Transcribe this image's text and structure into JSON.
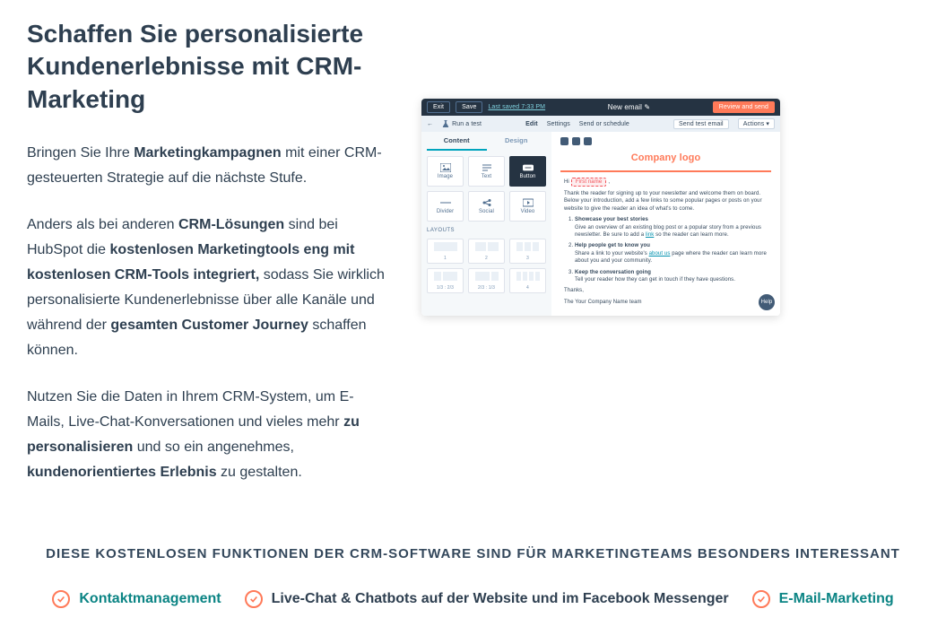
{
  "heading": "Schaffen Sie personalisierte Kundenerlebnisse mit CRM-Marketing",
  "paragraphs": {
    "p1a": "Bringen Sie Ihre ",
    "p1b": "Marketingkampagnen",
    "p1c": " mit einer CRM-gesteuerten Strategie auf die nächste Stufe.",
    "p2a": "Anders als bei anderen ",
    "p2b": "CRM-Lösungen",
    "p2c": " sind bei HubSpot die ",
    "p2d": "kostenlosen Marketingtools eng mit kostenlosen CRM-Tools integriert,",
    "p2e": " sodass Sie wirklich personalisierte Kundenerlebnisse über alle Kanäle und während der ",
    "p2f": "gesamten Customer Journey",
    "p2g": " schaffen können.",
    "p3a": "Nutzen Sie die Daten in Ihrem CRM-System, um E-Mails, Live-Chat-Konversationen und vieles mehr ",
    "p3b": "zu personalisieren",
    "p3c": " und so ein angenehmes, ",
    "p3d": "kundenorientiertes Erlebnis",
    "p3e": " zu gestalten."
  },
  "editor": {
    "exit": "Exit",
    "save": "Save",
    "last_saved": "Last saved 7:33 PM",
    "title": "New email",
    "pencil": "✎",
    "review": "Review and send",
    "back": "←",
    "run_test": "Run a test",
    "tabs_top": {
      "edit": "Edit",
      "settings": "Settings",
      "send": "Send or schedule"
    },
    "send_test": "Send test email",
    "actions": "Actions ▾",
    "side_tabs": {
      "content": "Content",
      "design": "Design"
    },
    "blocks": {
      "image": "Image",
      "text": "Text",
      "button": "Button",
      "divider": "Divider",
      "social": "Social",
      "video": "Video"
    },
    "layouts_label": "LAYOUTS",
    "layouts": [
      "1",
      "2",
      "3",
      "1/3 : 2/3",
      "2/3 : 1/3",
      "4"
    ],
    "logo": "Company logo",
    "token": "First name",
    "greeting": "Hi",
    "body_intro": "Thank the reader for signing up to your newsletter and welcome them on board. Below your introduction, add a few links to some popular pages or posts on your website to give the reader an idea of what's to come.",
    "li1_title": "Showcase your best stories",
    "li1_body_a": "Give an overview of an existing blog post or a popular story from a previous newsletter. Be sure to add a ",
    "li1_body_link": "link",
    "li1_body_b": " so the reader can learn more.",
    "li2_title": "Help people get to know you",
    "li2_body_a": "Share a link to your website's ",
    "li2_body_link": "about us",
    "li2_body_b": " page where the reader can learn more about you and your community.",
    "li3_title": "Keep the conversation going",
    "li3_body": "Tell your reader how they can get in touch if they have questions.",
    "signoff1": "Thanks,",
    "signoff2": "The Your Company Name team",
    "help": "Help"
  },
  "subhead": "DIESE KOSTENLOSEN FUNKTIONEN DER CRM-SOFTWARE SIND FÜR MARKETINGTEAMS BESONDERS INTERESSANT",
  "chips": {
    "c1": "Kontaktmanagement",
    "c2": "Live-Chat & Chatbots auf der Website und im Facebook Messenger",
    "c3": "E-Mail-Marketing"
  }
}
